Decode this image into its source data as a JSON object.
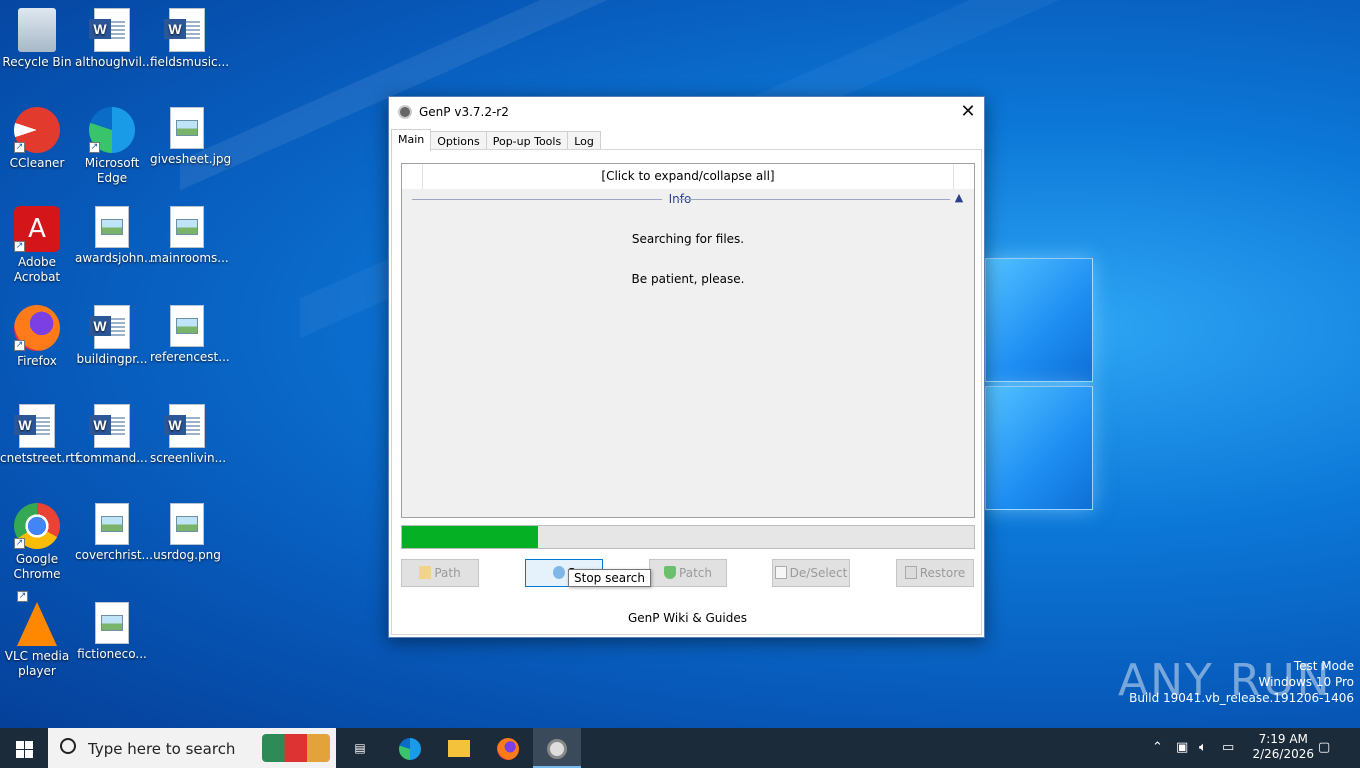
{
  "desktop": {
    "icons": [
      {
        "label": "Recycle Bin",
        "icon": "recycle-bin-icon"
      },
      {
        "label": "althoughvil...",
        "icon": "word-doc-icon"
      },
      {
        "label": "fieldsmusic...",
        "icon": "word-doc-icon"
      },
      {
        "label": "CCleaner",
        "icon": "ccleaner-icon"
      },
      {
        "label": "Microsoft Edge",
        "icon": "edge-icon"
      },
      {
        "label": "givesheet.jpg",
        "icon": "image-file-icon"
      },
      {
        "label": "Adobe Acrobat",
        "icon": "acrobat-icon"
      },
      {
        "label": "awardsjohn...",
        "icon": "image-file-icon"
      },
      {
        "label": "mainrooms...",
        "icon": "image-file-icon"
      },
      {
        "label": "Firefox",
        "icon": "firefox-icon"
      },
      {
        "label": "buildingpr...",
        "icon": "word-doc-icon"
      },
      {
        "label": "referencest...",
        "icon": "image-file-icon"
      },
      {
        "label": "cnetstreet.rtf",
        "icon": "word-doc-icon"
      },
      {
        "label": "command...",
        "icon": "word-doc-icon"
      },
      {
        "label": "screenlivin...",
        "icon": "word-doc-icon"
      },
      {
        "label": "Google Chrome",
        "icon": "chrome-icon"
      },
      {
        "label": "coverchrist...",
        "icon": "image-file-icon"
      },
      {
        "label": "usrdog.png",
        "icon": "image-file-icon"
      },
      {
        "label": "VLC media player",
        "icon": "vlc-icon"
      },
      {
        "label": "fictioneco...",
        "icon": "image-file-icon"
      }
    ]
  },
  "window": {
    "title": "GenP v3.7.2-r2",
    "close_glyph": "✕",
    "tabs": [
      {
        "label": "Main",
        "active": true
      },
      {
        "label": "Options",
        "active": false
      },
      {
        "label": "Pop-up Tools",
        "active": false
      },
      {
        "label": "Log",
        "active": false
      }
    ],
    "expand_label": "[Click to expand/collapse all]",
    "info_label": "Info",
    "messages": [
      "Searching for files.",
      "Be patient, please."
    ],
    "progress_fraction": 0.237,
    "buttons": [
      {
        "label": "Path",
        "icon": "folder-icon"
      },
      {
        "label": "S",
        "icon": "search-icon"
      },
      {
        "label": "Patch",
        "icon": "shield-check-icon"
      },
      {
        "label": "De/Select",
        "icon": "checkbox-icon"
      },
      {
        "label": "Restore",
        "icon": "restore-icon"
      }
    ],
    "tooltip": "Stop search",
    "wiki_link": "GenP Wiki & Guides"
  },
  "watermark": {
    "brand": "ANY RUN",
    "line1": "Test Mode",
    "line2": "Windows 10 Pro",
    "line3": "Build 19041.vb_release.191206-1406"
  },
  "taskbar": {
    "search_placeholder": "Type here to search",
    "time": "7:19 AM",
    "date": "2/26/2026",
    "pinned": [
      "task-view-icon",
      "edge-icon",
      "file-explorer-icon",
      "firefox-icon",
      "genp-icon"
    ]
  },
  "colors": {
    "progress": "#06b025",
    "accent": "#0078d7",
    "info_header": "#2b3f8c"
  }
}
